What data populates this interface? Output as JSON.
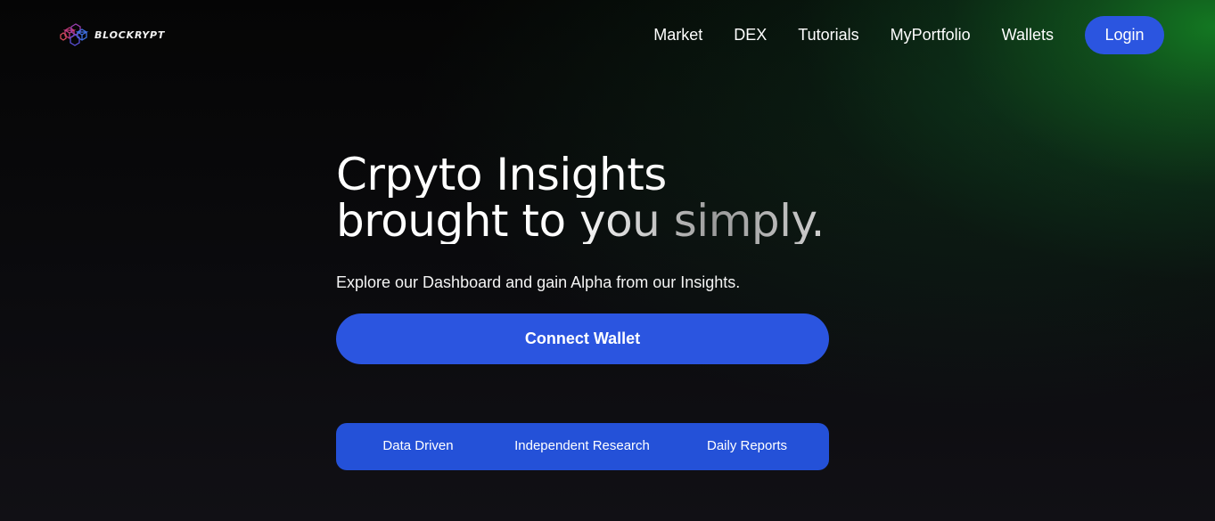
{
  "brand": {
    "name": "BLOCKRYPT",
    "icon": "blockchain-cubes-icon",
    "accent": "#2b55e0"
  },
  "nav": {
    "items": [
      {
        "label": "Market"
      },
      {
        "label": "DEX"
      },
      {
        "label": "Tutorials"
      },
      {
        "label": "MyPortfolio"
      },
      {
        "label": "Wallets"
      }
    ],
    "login_label": "Login"
  },
  "hero": {
    "title_line1": "Crpyto Insights",
    "title_line2": "brought to you simply.",
    "subtitle": "Explore our Dashboard and gain Alpha from our Insights.",
    "cta_label": "Connect Wallet"
  },
  "features": {
    "items": [
      {
        "label": "Data Driven"
      },
      {
        "label": "Independent Research"
      },
      {
        "label": "Daily Reports"
      }
    ]
  },
  "colors": {
    "background": "#0b0b0e",
    "green_glow": "#147d23",
    "button_blue": "#2b55e0",
    "features_blue": "#2451d8"
  }
}
